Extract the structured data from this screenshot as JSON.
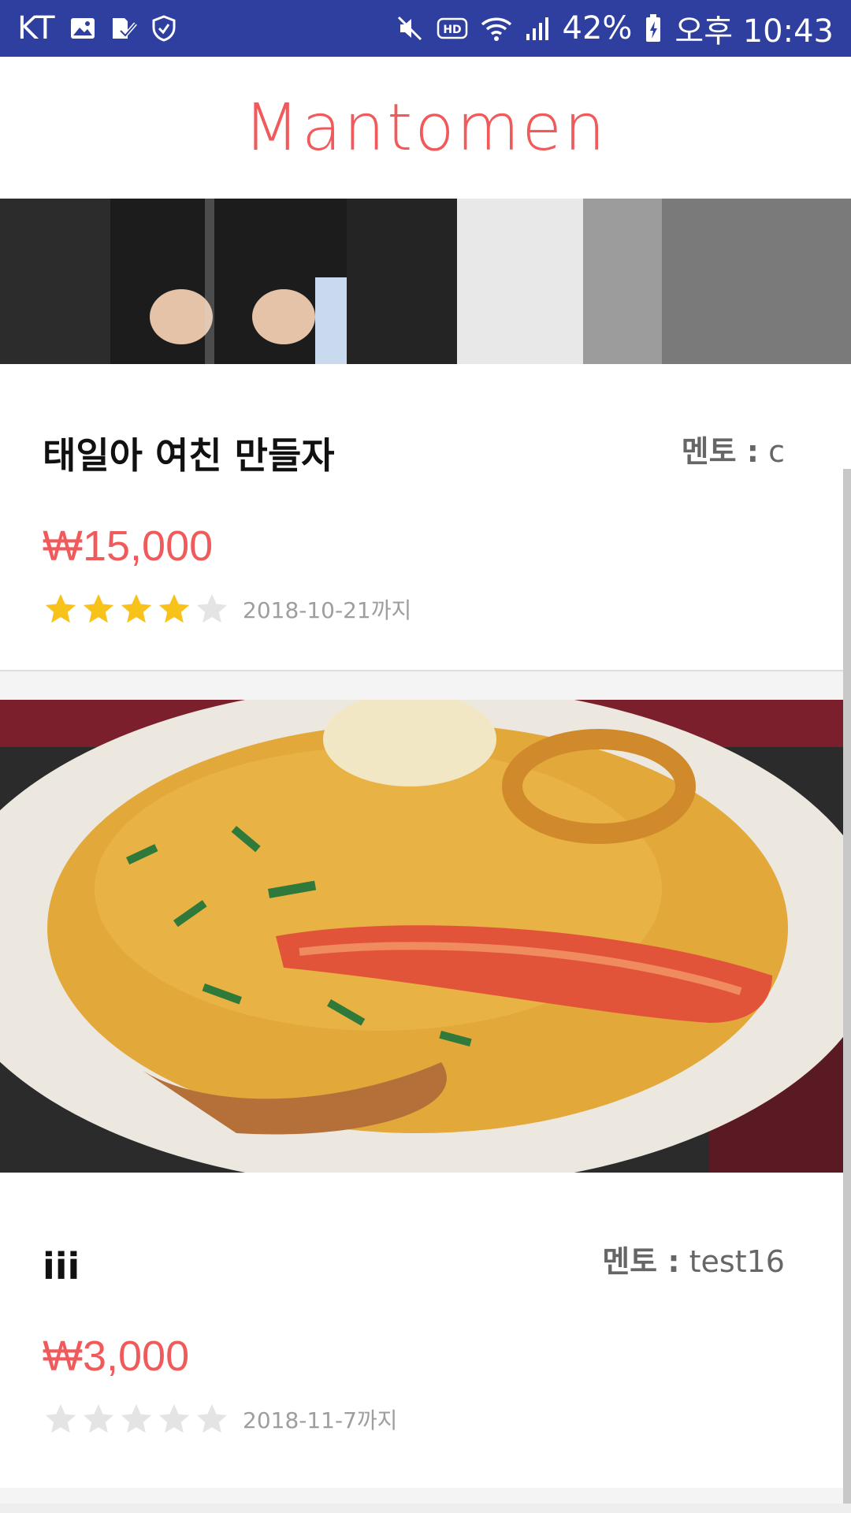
{
  "status_bar": {
    "carrier": "KT",
    "battery_percent": "42%",
    "time": "오후 10:43",
    "left_icons": [
      "gallery-icon",
      "task-check-icon",
      "shield-check-icon"
    ],
    "right_icons": [
      "mute-icon",
      "hd-icon",
      "wifi-icon",
      "signal-icon",
      "battery-charging-icon"
    ]
  },
  "app": {
    "logo": "Mantomen",
    "accent_color": "#f05a5b",
    "status_color": "#2e3f9f"
  },
  "cards": [
    {
      "title": "태일아 여친 만들자",
      "mentor_label": "멘토 :",
      "mentor_name": "c",
      "price": "₩15,000",
      "rating": 4,
      "rating_max": 5,
      "deadline": "2018-10-21까지"
    },
    {
      "title": "iii",
      "mentor_label": "멘토 :",
      "mentor_name": "test16",
      "price": "₩3,000",
      "rating": 0,
      "rating_max": 5,
      "deadline": "2018-11-7까지"
    }
  ]
}
